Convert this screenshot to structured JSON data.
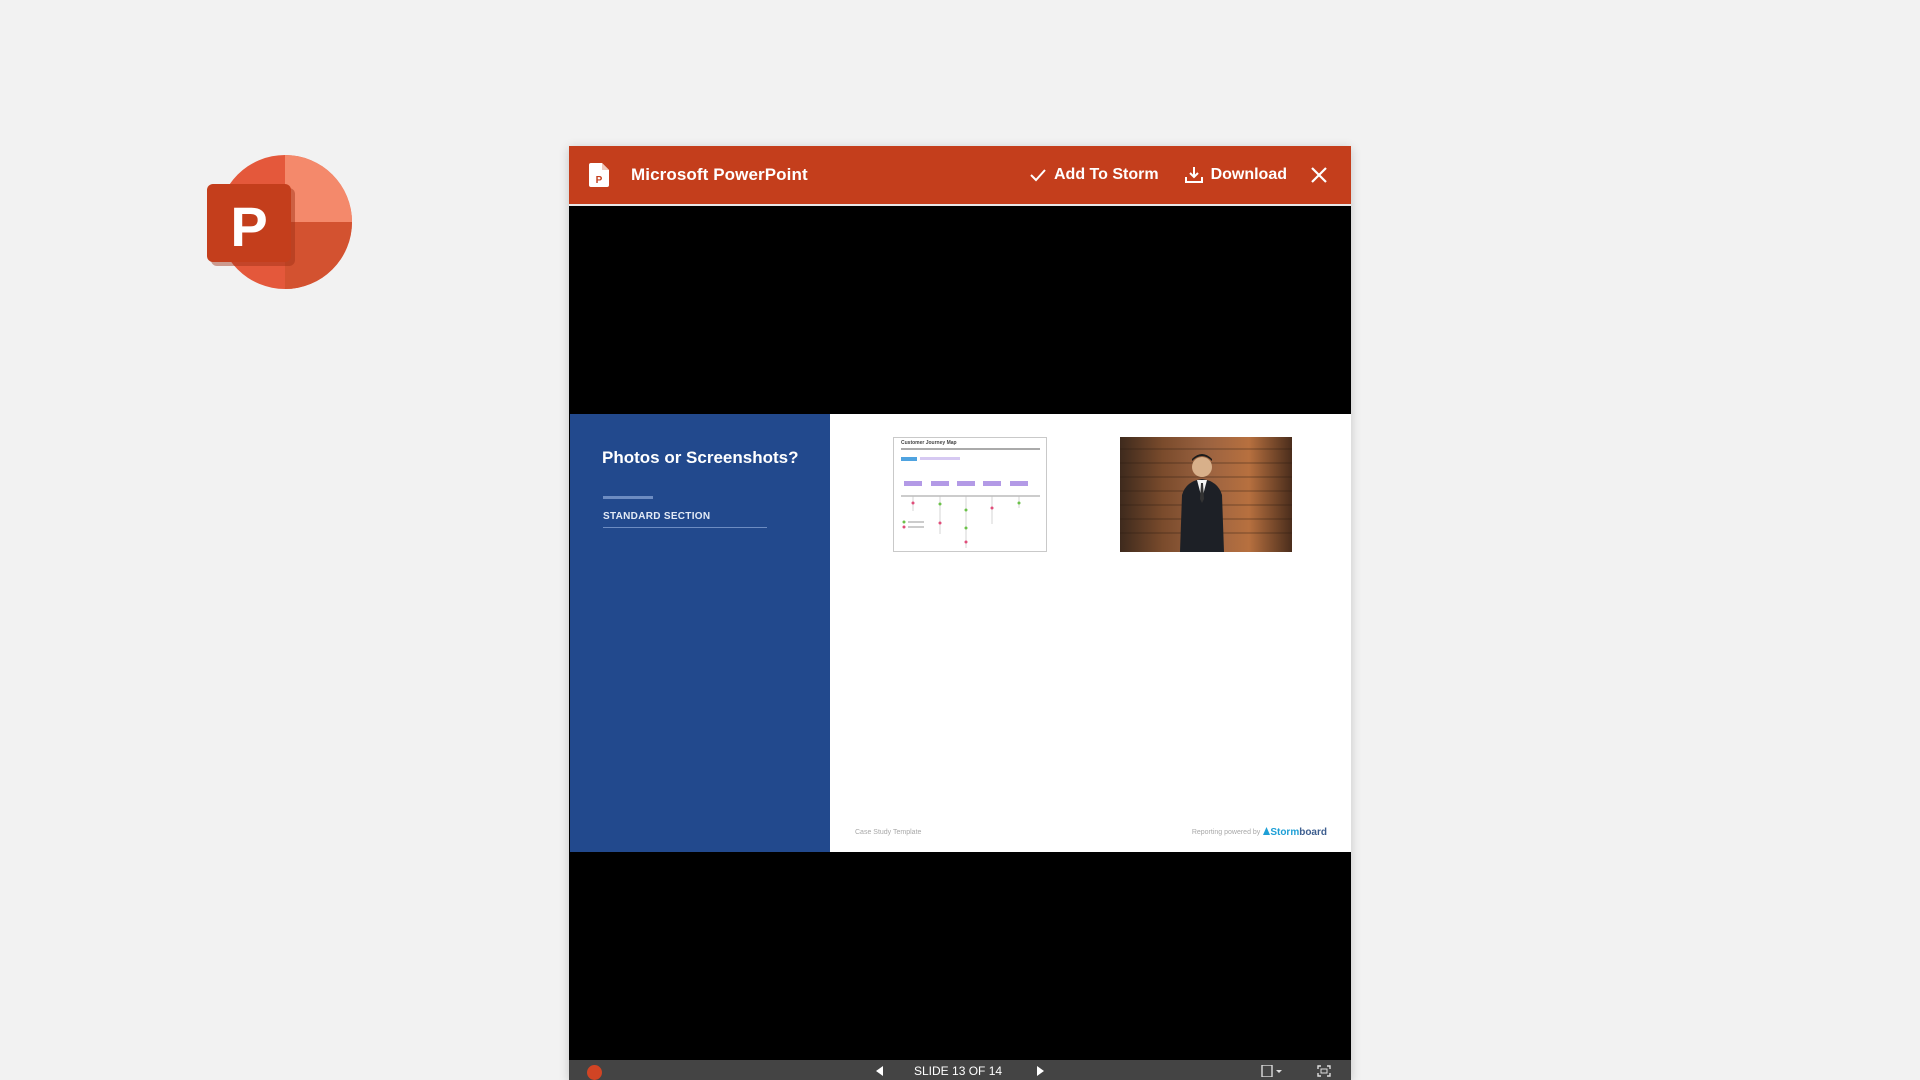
{
  "app": {
    "logo_letter": "P",
    "brand_color": "#c43e1c"
  },
  "viewer": {
    "title": "Microsoft PowerPoint",
    "file_icon": "powerpoint-file-icon",
    "actions": {
      "add_to_storm": "Add To Storm",
      "download": "Download",
      "close_icon": "close-icon"
    }
  },
  "slide": {
    "title": "Photos or Screenshots?",
    "section": "STANDARD SECTION",
    "left_panel_color": "#22498d",
    "thumbnails": {
      "journey_map_title": "Customer Journey Map"
    },
    "footer_left": "Case Study Template",
    "footer_right": "Reporting powered by",
    "brand_prefix": "Storm",
    "brand_suffix": "board"
  },
  "toolbar": {
    "slide_counter": "SLIDE 13 OF 14",
    "prev_icon": "triangle-left-icon",
    "next_icon": "triangle-right-icon",
    "view_icon": "notes-view-icon",
    "fit_icon": "fullscreen-icon"
  }
}
